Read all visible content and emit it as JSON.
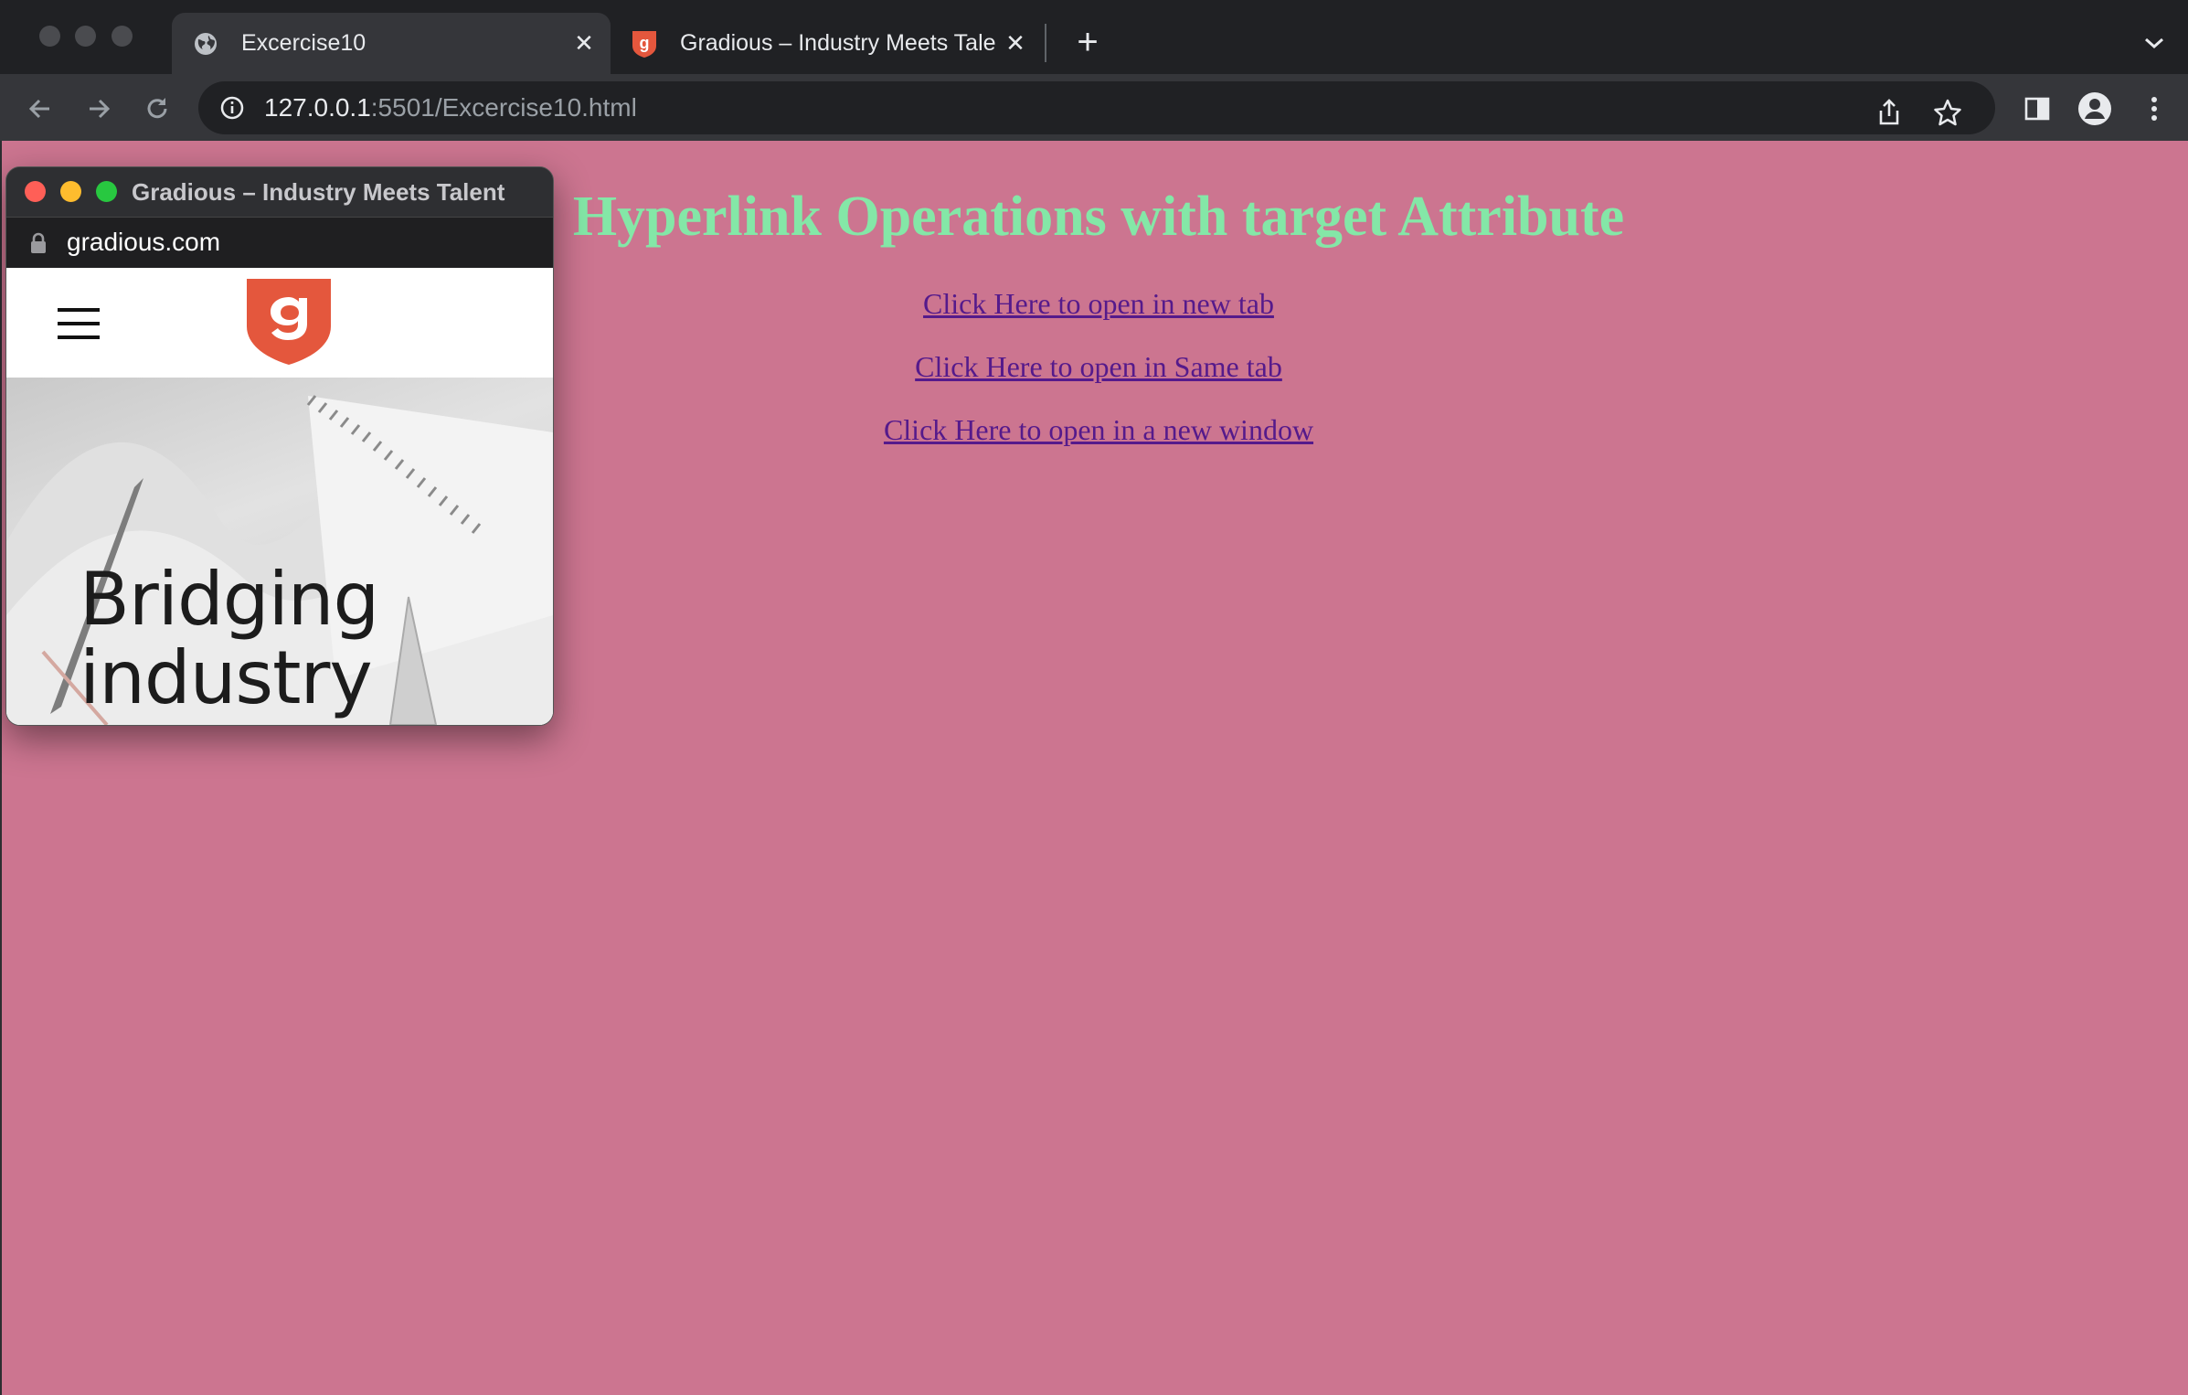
{
  "browser": {
    "tabs": [
      {
        "title": "Excercise10",
        "active": true
      },
      {
        "title": "Gradious – Industry Meets Tale",
        "active": false
      }
    ],
    "url_host": "127.0.0.1",
    "url_rest": ":5501/Excercise10.html"
  },
  "page": {
    "heading": "Hyperlink Operations with target Attribute",
    "links": [
      "Click Here to open in new tab",
      "Click Here to open in Same tab",
      "Click Here to open in a new window"
    ],
    "background_color": "#cc7590",
    "heading_color": "#84e7a7",
    "link_color": "#551a8b"
  },
  "popup": {
    "window_title": "Gradious – Industry Meets Talent",
    "host": "gradious.com",
    "hero_line1": "Bridging",
    "hero_line2": "industry",
    "logo_color": "#e4573d"
  }
}
